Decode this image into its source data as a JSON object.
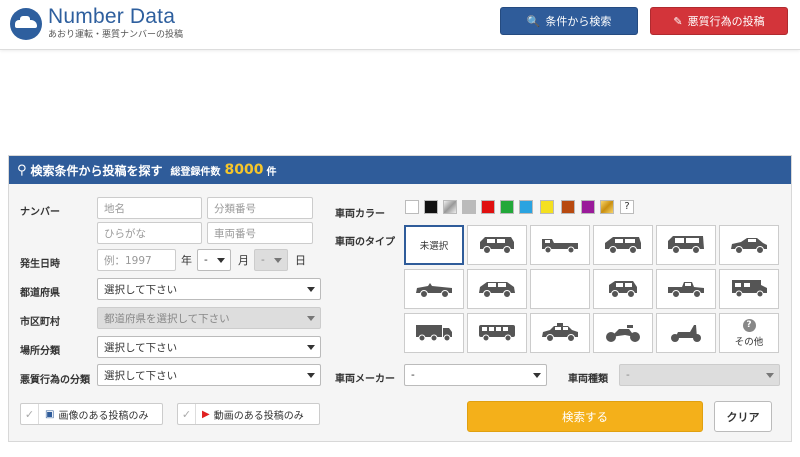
{
  "header": {
    "logo_title": "Number Data",
    "logo_subtitle": "あおり運転・悪質ナンバーの投稿",
    "search_button": "条件から検索",
    "post_button": "悪質行為の投稿"
  },
  "panel": {
    "title": "検索条件から投稿を探す",
    "count_label": "総登録件数",
    "count_value": "8000",
    "count_unit": "件"
  },
  "form": {
    "number_label": "ナンバー",
    "place_placeholder": "地名",
    "class_placeholder": "分類番号",
    "hiragana_placeholder": "ひらがな",
    "vehicle_number_placeholder": "車両番号",
    "date_label": "発生日時",
    "year_placeholder": "例：1997",
    "year_unit": "年",
    "month_value": "-",
    "month_unit": "月",
    "day_value": "-",
    "day_unit": "日",
    "prefecture_label": "都道府県",
    "prefecture_value": "選択して下さい",
    "city_label": "市区町村",
    "city_value": "都道府県を選択して下さい",
    "place_type_label": "場所分類",
    "place_type_value": "選択して下さい",
    "behavior_label": "悪質行為の分類",
    "behavior_value": "選択して下さい",
    "color_label": "車両カラー",
    "color_other": "?",
    "type_label": "車両のタイプ",
    "type_unselected": "未選択",
    "type_other": "その他",
    "maker_label": "車両メーカー",
    "maker_value": "-",
    "model_label": "車両種類",
    "model_value": "-",
    "image_only": "画像のある投稿のみ",
    "video_only": "動画のある投稿のみ",
    "search_button": "検索する",
    "clear_button": "クリア"
  },
  "colors": {
    "primary": "#2f5c9a",
    "danger": "#d3343a",
    "accent": "#f4b01a",
    "swatches": [
      "#ffffff",
      "#111111",
      "#silver",
      "#bbbbbb",
      "#e01010",
      "#23a83a",
      "#2aa3e0",
      "#f4e020",
      "#b84a10",
      "#9a1b9a",
      "#gold"
    ]
  }
}
